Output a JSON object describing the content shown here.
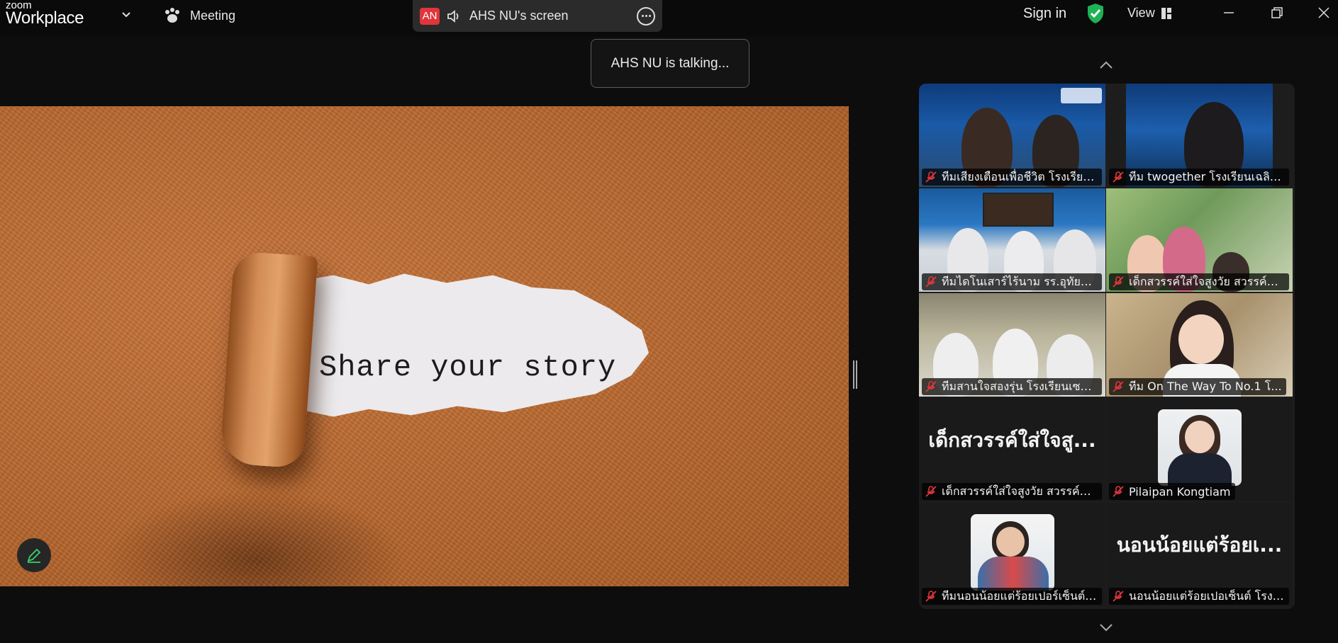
{
  "app": {
    "brand_top": "zoom",
    "brand_bottom": "Workplace",
    "meeting_label": "Meeting"
  },
  "share": {
    "badge": "AN",
    "title": "AHS NU's screen"
  },
  "header": {
    "sign_in": "Sign in",
    "view": "View"
  },
  "toast": "AHS NU is talking...",
  "slide": {
    "text": "Share your story"
  },
  "participants": [
    {
      "name": "ทีมเสียงเตือนเพื่อชีวิต โรงเรียน...",
      "muted": true
    },
    {
      "name": "ทีม twogether โรงเรียนเฉลิม...",
      "muted": true
    },
    {
      "name": "ทีมไดโนเสาร์ไร้นาม รร.อุทัยวิท...",
      "muted": true
    },
    {
      "name": "เด็กสวรรค์ใส่ใจสูงวัย สวรรค์อน...",
      "muted": true
    },
    {
      "name": "ทีมสานใจสองรุ่น โรงเรียนเซนต์...",
      "muted": true
    },
    {
      "name": "ทีม On The Way To No.1 โ...",
      "muted": true
    },
    {
      "name": "เด็กสวรรค์ใส่ใจสูงวัย สวรรค์อน...",
      "muted": true,
      "avatar_text": "เด็กสวรรค์ใส่ใจสู..."
    },
    {
      "name": "Pilaipan Kongtiam",
      "muted": true
    },
    {
      "name": "ทีมนอนน้อยแต่ร้อยเปอร์เซ็นต์ ...",
      "muted": true
    },
    {
      "name": "นอนน้อยแต่ร้อยเปอเซ็นต์ โรงเ...",
      "muted": true,
      "avatar_text": "นอนน้อยแต่ร้อยเ..."
    }
  ],
  "colors": {
    "muted_mic": "#e0363b",
    "shield": "#1fb254",
    "badge": "#e0363b"
  }
}
